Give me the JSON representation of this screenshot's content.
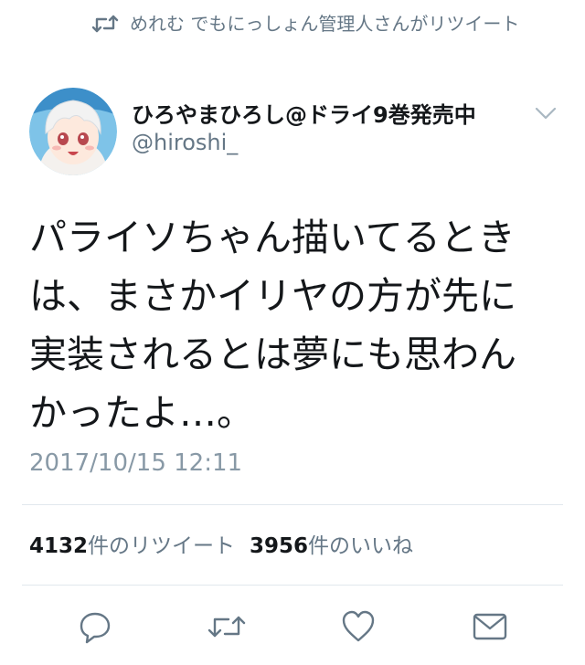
{
  "retweet_context": {
    "text": "めれむ でもにっしょん管理人さんがリツイート"
  },
  "author": {
    "display_name": "ひろやまひろし@ドライ9巻発売中",
    "handle": "@hiroshi_"
  },
  "tweet": {
    "text_lines": [
      "パライソちゃん描いてるとき",
      "は、まさかイリヤの方が先に",
      "実装されるとは夢にも思わん",
      "かったよ…。"
    ],
    "timestamp": "2017/10/15 12:11"
  },
  "stats": {
    "retweet_count": "4132",
    "retweet_label": "件のリツイート",
    "like_count": "3956",
    "like_label": "件のいいね"
  },
  "icons": {
    "retweet_context": "retweet-icon",
    "caret": "chevron-down-icon",
    "reply": "reply-icon",
    "retweet": "retweet-icon",
    "like": "heart-icon",
    "dm": "envelope-icon"
  },
  "colors": {
    "text_primary": "#14171a",
    "text_secondary": "#657786",
    "icon_gray": "#657786",
    "divider": "#e1e8ed"
  }
}
